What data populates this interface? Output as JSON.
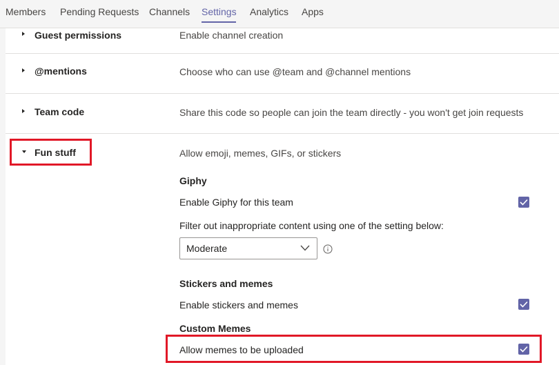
{
  "tabs": [
    "Members",
    "Pending Requests",
    "Channels",
    "Settings",
    "Analytics",
    "Apps"
  ],
  "sections": {
    "guest_permissions": {
      "title": "Guest permissions",
      "description": "Enable channel creation"
    },
    "mentions": {
      "title": "@mentions",
      "description": "Choose who can use @team and @channel mentions"
    },
    "team_code": {
      "title": "Team code",
      "description": "Share this code so people can join the team directly - you won't get join requests"
    },
    "fun_stuff": {
      "title": "Fun stuff",
      "description": "Allow emoji, memes, GIFs, or stickers",
      "giphy": {
        "heading": "Giphy",
        "enable_label": "Enable Giphy for this team",
        "enable_checked": true,
        "filter_label": "Filter out inappropriate content using one of the setting below:",
        "filter_value": "Moderate"
      },
      "stickers": {
        "heading": "Stickers and memes",
        "enable_label": "Enable stickers and memes",
        "enable_checked": true
      },
      "custom_memes": {
        "heading": "Custom Memes",
        "upload_label": "Allow memes to be uploaded",
        "upload_checked": true
      }
    }
  },
  "colors": {
    "accent": "#6264a7",
    "highlight": "#e11827"
  },
  "icons": [
    "caret-right-icon",
    "caret-down-icon",
    "checkmark-icon",
    "chevron-down-icon",
    "info-icon"
  ]
}
